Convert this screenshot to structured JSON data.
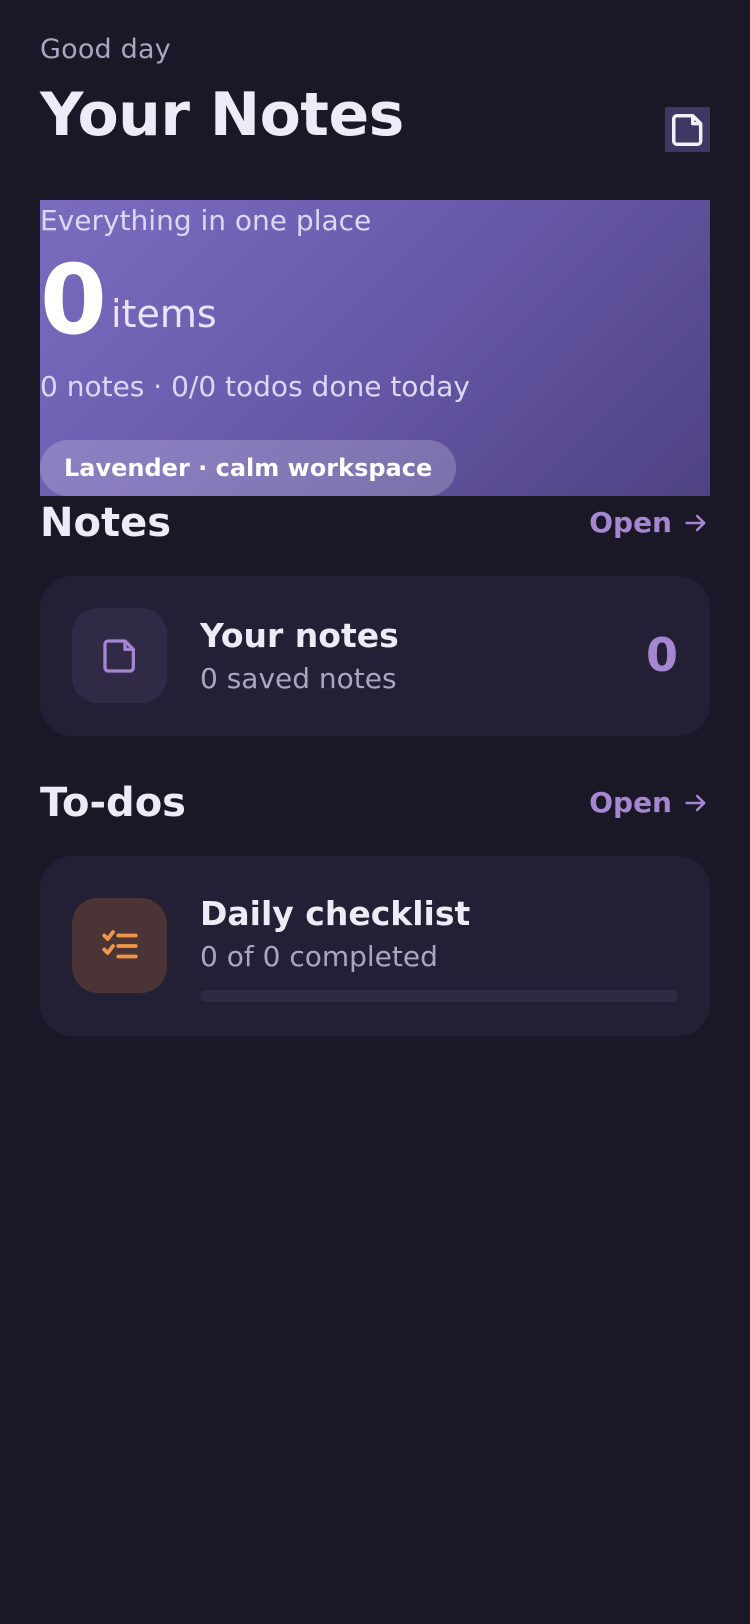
{
  "header": {
    "greeting": "Good day",
    "title": "Your Notes",
    "action_icon": "note-icon"
  },
  "hero": {
    "subtitle": "Everything in one place",
    "count": "0",
    "count_unit": "items",
    "stats": "0 notes · 0/0 todos done today",
    "theme_pill": "Lavender · calm workspace"
  },
  "notes_section": {
    "title": "Notes",
    "open_label": "Open",
    "card": {
      "icon": "note-icon",
      "title": "Your notes",
      "subtitle": "0 saved notes",
      "count": "0"
    }
  },
  "todos_section": {
    "title": "To-dos",
    "open_label": "Open",
    "card": {
      "icon": "checklist-icon",
      "title": "Daily checklist",
      "subtitle": "0 of 0 completed",
      "progress": 0
    }
  },
  "colors": {
    "background": "#1a1727",
    "accent": "#a586d0",
    "hero_gradient_start": "#7b6cc0",
    "hero_gradient_end": "#4f4282",
    "card": "#231f35",
    "checklist_accent": "#f0964a"
  }
}
